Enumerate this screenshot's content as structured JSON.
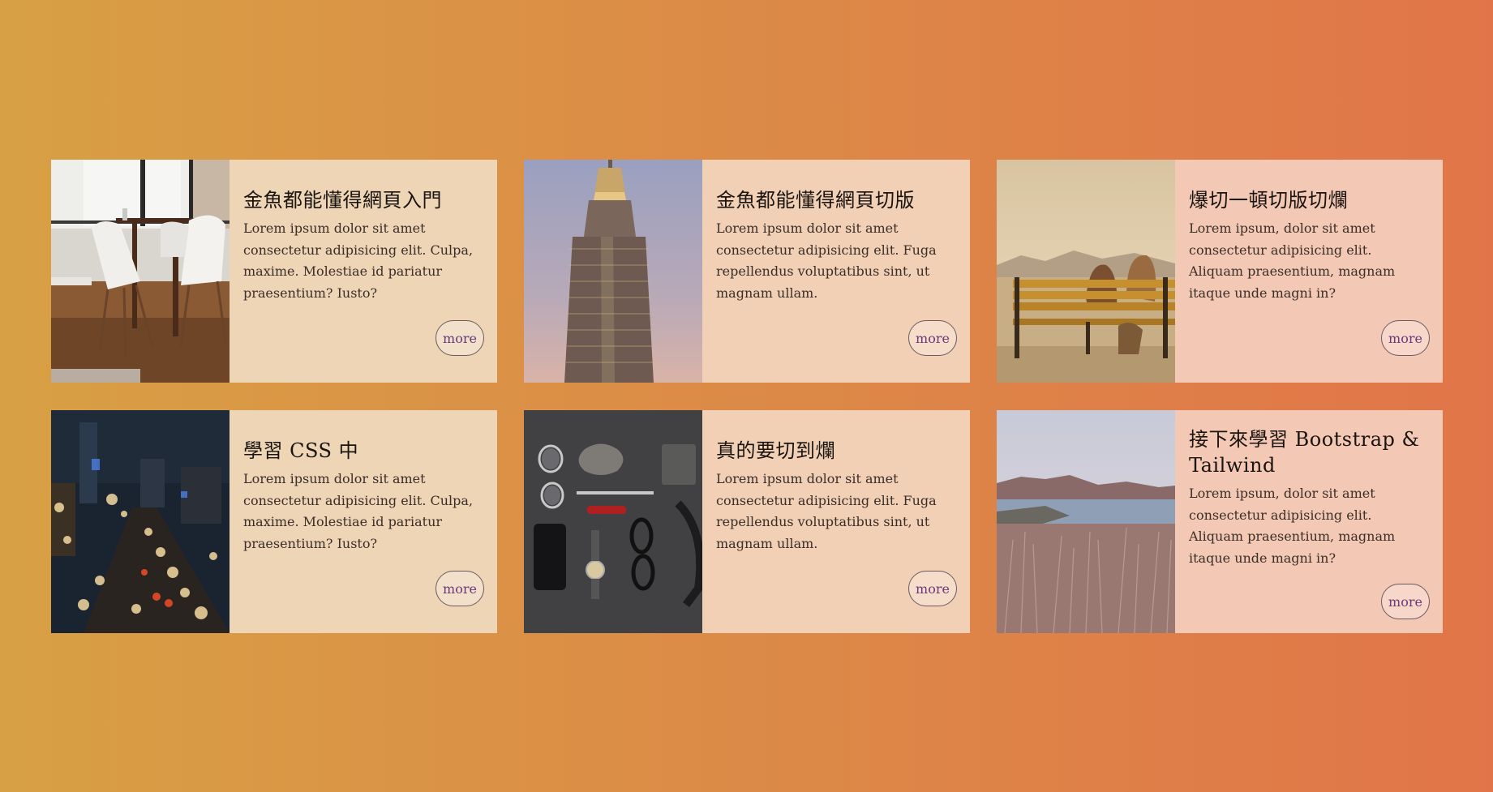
{
  "cards": [
    {
      "title": "金魚都能懂得網頁入門",
      "desc": "Lorem ipsum dolor sit amet consectetur adipisicing elit. Culpa, maxime. Molestiae id pariatur praesentium? Iusto?",
      "more_label": "more",
      "image": "dining-room-photo"
    },
    {
      "title": "金魚都能懂得網頁切版",
      "desc": "Lorem ipsum dolor sit amet consectetur adipisicing elit. Fuga repellendus voluptatibus sint, ut magnam ullam.",
      "more_label": "more",
      "image": "skyscraper-photo"
    },
    {
      "title": "爆切一頓切版切爛",
      "desc": "Lorem ipsum, dolor sit amet consectetur adipisicing elit. Aliquam praesentium, magnam itaque unde magni in?",
      "more_label": "more",
      "image": "couple-bench-photo"
    },
    {
      "title": "學習 CSS 中",
      "desc": "Lorem ipsum dolor sit amet consectetur adipisicing elit. Culpa, maxime. Molestiae id pariatur praesentium? Iusto?",
      "more_label": "more",
      "image": "city-night-photo"
    },
    {
      "title": "真的要切到爛",
      "desc": "Lorem ipsum dolor sit amet consectetur adipisicing elit. Fuga repellendus voluptatibus sint, ut magnam ullam.",
      "more_label": "more",
      "image": "flatlay-accessories-photo"
    },
    {
      "title": "接下來學習 Bootstrap & Tailwind",
      "desc": "Lorem ipsum, dolor sit amet consectetur adipisicing elit. Aliquam praesentium, magnam itaque unde magni in?",
      "more_label": "more",
      "image": "coastal-landscape-photo"
    }
  ],
  "colors": {
    "background_start": "#d8a044",
    "background_end": "#e17549",
    "more_text": "#6a3a7a"
  }
}
